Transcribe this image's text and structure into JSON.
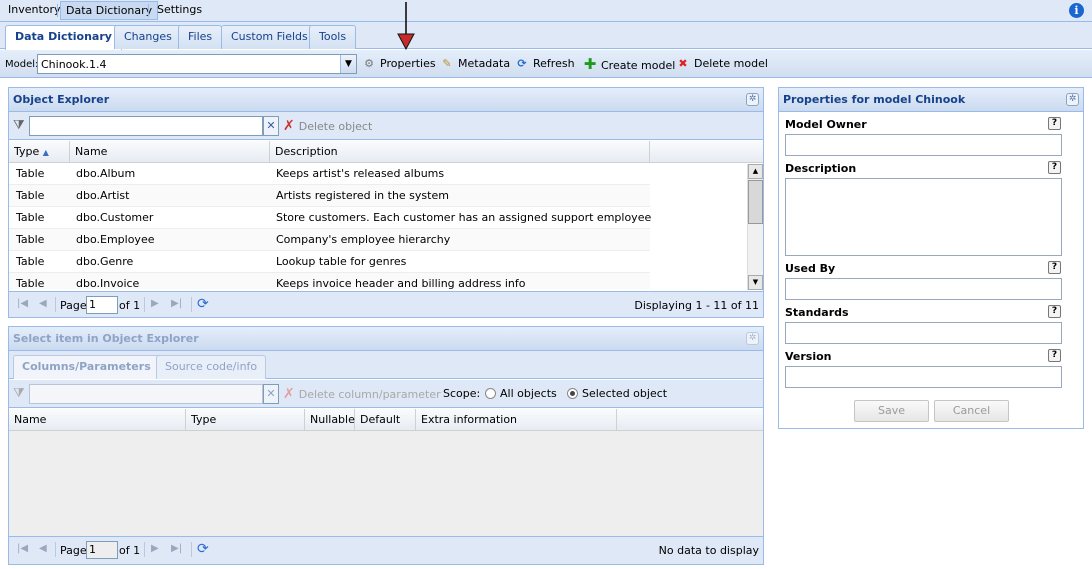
{
  "topmenu": {
    "items": [
      "Inventory",
      "Data Dictionary",
      "Settings"
    ],
    "info_icon": "info-icon"
  },
  "tabs": [
    "Data Dictionary",
    "Changes",
    "Files",
    "Custom Fields",
    "Tools"
  ],
  "toolbar": {
    "model_label": "Model:",
    "model_value": "Chinook.1.4",
    "properties": "Properties",
    "metadata": "Metadata",
    "refresh": "Refresh",
    "create_model": "Create model",
    "delete_model": "Delete model"
  },
  "object_explorer": {
    "title": "Object Explorer",
    "filter_value": "",
    "delete_object": "Delete object",
    "columns": [
      "Type",
      "Name",
      "Description"
    ],
    "rows": [
      {
        "type": "Table",
        "name": "dbo.Album",
        "description": "Keeps artist's released albums"
      },
      {
        "type": "Table",
        "name": "dbo.Artist",
        "description": "Artists registered in the system"
      },
      {
        "type": "Table",
        "name": "dbo.Customer",
        "description": "Store customers. Each customer has an assigned support employee"
      },
      {
        "type": "Table",
        "name": "dbo.Employee",
        "description": "Company's employee hierarchy"
      },
      {
        "type": "Table",
        "name": "dbo.Genre",
        "description": "Lookup table for genres"
      },
      {
        "type": "Table",
        "name": "dbo.Invoice",
        "description": "Keeps invoice header and billing address info"
      }
    ],
    "paging": {
      "page_label": "Page",
      "page": "1",
      "of": "of 1",
      "display": "Displaying 1 - 11 of 11"
    }
  },
  "select_panel": {
    "title": "Select item in Object Explorer",
    "tabs": [
      "Columns/Parameters",
      "Source code/info"
    ],
    "delete_column": "Delete column/parameter",
    "scope_label": "Scope:",
    "scope_all": "All objects",
    "scope_selected": "Selected object",
    "columns": [
      "Name",
      "Type",
      "Nullable",
      "Default",
      "Extra information"
    ],
    "paging": {
      "page_label": "Page",
      "page": "1",
      "of": "of 1",
      "display": "No data to display"
    }
  },
  "properties": {
    "title": "Properties for model Chinook",
    "fields": {
      "owner": {
        "label": "Model Owner",
        "value": ""
      },
      "description": {
        "label": "Description",
        "value": ""
      },
      "used_by": {
        "label": "Used By",
        "value": ""
      },
      "standards": {
        "label": "Standards",
        "value": ""
      },
      "version": {
        "label": "Version",
        "value": ""
      }
    },
    "help": "?",
    "save": "Save",
    "cancel": "Cancel"
  }
}
